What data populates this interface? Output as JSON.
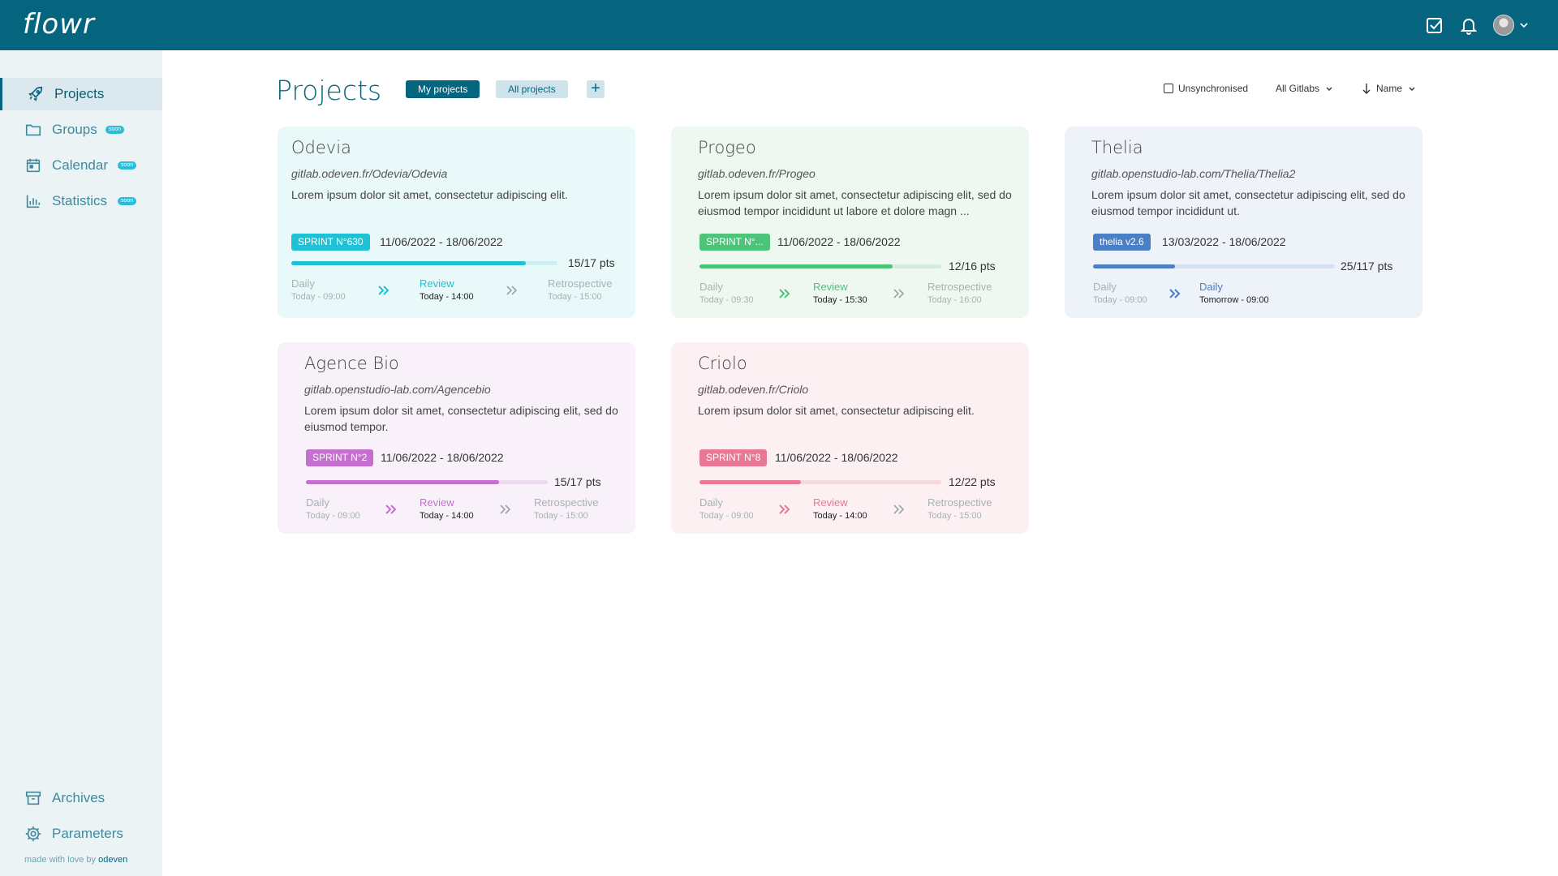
{
  "app": {
    "logo": "flowr"
  },
  "colors": {
    "brand": "#05657f",
    "odevia": "#1fc2d4",
    "progeo": "#4ec37a",
    "thelia": "#4a7fc5",
    "agence_bio": "#c56fd0",
    "criolo": "#e87896"
  },
  "topbar": {
    "icons": [
      "checkbox-icon",
      "bell-icon",
      "avatar",
      "chevron-down-icon"
    ]
  },
  "sidebar": {
    "items": [
      {
        "label": "Projects",
        "icon": "rocket-icon",
        "badge": ""
      },
      {
        "label": "Groups",
        "icon": "folder-icon",
        "badge": "soon"
      },
      {
        "label": "Calendar",
        "icon": "calendar-icon",
        "badge": "soon"
      },
      {
        "label": "Statistics",
        "icon": "bar-chart-icon",
        "badge": "soon"
      }
    ],
    "bottom": [
      {
        "label": "Archives",
        "icon": "archive-icon"
      },
      {
        "label": "Parameters",
        "icon": "gear-icon"
      }
    ],
    "made_by": "made with love by",
    "made_by_brand": "odeven"
  },
  "header": {
    "title": "Projects",
    "my_projects": "My projects",
    "all_projects": "All projects",
    "add": "+",
    "unsynchronised": "Unsynchronised",
    "gitlabs": "All Gitlabs",
    "sort": "Name"
  },
  "projects": [
    {
      "name": "Odevia",
      "url": "gitlab.odeven.fr/Odevia/Odevia",
      "desc": "Lorem ipsum dolor sit amet, consectetur adipiscing elit.",
      "tag": "SPRINT N°630",
      "dates": "11/06/2022 - 18/06/2022",
      "progress": 0.88,
      "pts": "15/17 pts",
      "steps": [
        {
          "name": "Daily",
          "time": "Today - 09:00"
        },
        {
          "name": "Review",
          "time": "Today - 14:00"
        },
        {
          "name": "Retrospective",
          "time": "Today - 15:00"
        }
      ]
    },
    {
      "name": "Progeo",
      "url": "gitlab.odeven.fr/Progeo",
      "desc": "Lorem ipsum dolor sit amet, consectetur adipiscing elit, sed do eiusmod tempor incididunt ut labore et dolore magn ...",
      "tag": "SPRINT N°...",
      "dates": "11/06/2022 - 18/06/2022",
      "progress": 0.8,
      "pts": "12/16 pts",
      "steps": [
        {
          "name": "Daily",
          "time": "Today - 09:30"
        },
        {
          "name": "Review",
          "time": "Today - 15:30"
        },
        {
          "name": "Retrospective",
          "time": "Today - 16:00"
        }
      ]
    },
    {
      "name": "Thelia",
      "url": "gitlab.openstudio-lab.com/Thelia/Thelia2",
      "desc": "Lorem ipsum dolor sit amet, consectetur adipiscing elit, sed do eiusmod tempor incididunt ut.",
      "tag": "thelia v2.6",
      "dates": "13/03/2022 - 18/06/2022",
      "progress": 0.34,
      "pts": "25/117 pts",
      "steps": [
        {
          "name": "Daily",
          "time": "Today - 09:00"
        },
        {
          "name": "Daily",
          "time": "Tomorrow - 09:00"
        }
      ]
    },
    {
      "name": "Agence Bio",
      "url": "gitlab.openstudio-lab.com/Agencebio",
      "desc": "Lorem ipsum dolor sit amet, consectetur adipiscing elit, sed do eiusmod tempor.",
      "tag": "SPRINT N°2",
      "dates": "11/06/2022 - 18/06/2022",
      "progress": 0.8,
      "pts": "15/17 pts",
      "steps": [
        {
          "name": "Daily",
          "time": "Today - 09:00"
        },
        {
          "name": "Review",
          "time": "Today - 14:00"
        },
        {
          "name": "Retrospective",
          "time": "Today - 15:00"
        }
      ]
    },
    {
      "name": "Criolo",
      "url": "gitlab.odeven.fr/Criolo",
      "desc": "Lorem ipsum dolor sit amet, consectetur adipiscing elit.",
      "tag": "SPRINT N°8",
      "dates": "11/06/2022 - 18/06/2022",
      "progress": 0.42,
      "pts": "12/22 pts",
      "steps": [
        {
          "name": "Daily",
          "time": "Today - 09:00"
        },
        {
          "name": "Review",
          "time": "Today - 14:00"
        },
        {
          "name": "Retrospective",
          "time": "Today - 15:00"
        }
      ]
    }
  ]
}
